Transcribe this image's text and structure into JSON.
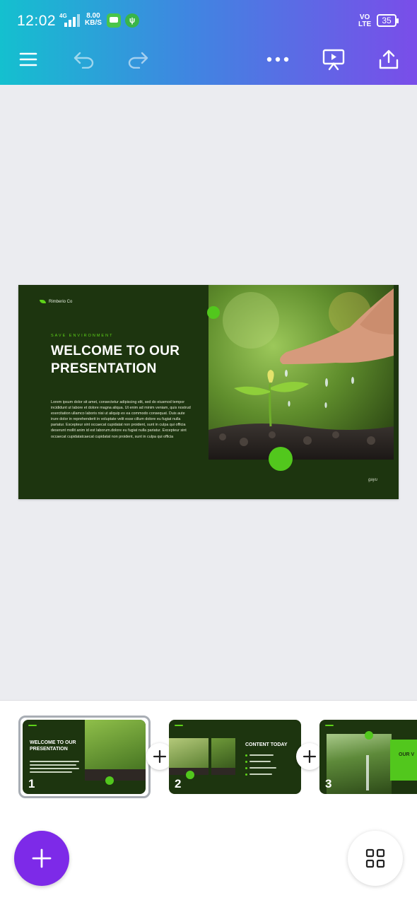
{
  "status_bar": {
    "time": "12:02",
    "network": "4G",
    "speed_value": "8.00",
    "speed_unit": "KB/S",
    "volte_line1": "VO",
    "volte_line2": "LTE",
    "battery": "35"
  },
  "toolbar": {
    "icons": [
      "menu-icon",
      "undo-icon",
      "redo-icon",
      "more-icon",
      "present-icon",
      "share-icon"
    ]
  },
  "slide": {
    "brand": "Rimberio Co",
    "kicker": "SAVE ENVIRONMENT",
    "title": "WELCOME TO OUR PRESENTATION",
    "body": "Lorem ipsum dolor sit amet, consectetur adipiscing elit, sed do eiusmod tempor incididunt ut labore et dolore magna aliqua. Ut enim ad minim veniam, quis nostrud exercitation ullamco laboris nisi ut aliquip ex ea commodo consequat. Duis aute irure dolor in reprehenderit in voluptate velit esse cillum dolore eu fugiat nulla pariatur. Excepteur sint occaecat cupidatat non proident, sunt in culpa qui officia deserunt mollit anim id est laborum.dolore eu fugiat nulla pariatur. Excepteur sint occaecat cupidatatcaecat cupidatat non proident, sunt in culpa qui officia",
    "signature": "gayu",
    "accent": "#52c71d",
    "background": "#1d350f"
  },
  "thumbnails": [
    {
      "number": "1",
      "title": "WELCOME TO OUR PRESENTATION",
      "selected": true
    },
    {
      "number": "2",
      "title": "CONTENT TODAY",
      "selected": false
    },
    {
      "number": "3",
      "title": "OUR V",
      "selected": false
    }
  ],
  "fab": {
    "icon": "plus-icon",
    "color": "#7d2ae8"
  },
  "grid_button": {
    "icon": "grid-icon"
  }
}
